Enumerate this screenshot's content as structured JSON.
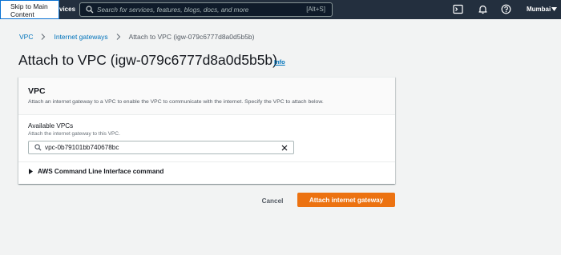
{
  "topnav": {
    "skip_link": "Skip to Main Content",
    "services_fragment": "vices",
    "search": {
      "placeholder": "Search for services, features, blogs, docs, and more",
      "shortcut": "[Alt+S]"
    },
    "icons": [
      "cloudshell-icon",
      "bell-icon",
      "help-icon"
    ],
    "region": "Mumbai"
  },
  "breadcrumb": {
    "items": [
      "VPC",
      "Internet gateways"
    ],
    "current": "Attach to VPC (igw-079c6777d8a0d5b5b)"
  },
  "page": {
    "title": "Attach to VPC (igw-079c6777d8a0d5b5b)",
    "info_link": "Info"
  },
  "vpc_section": {
    "title": "VPC",
    "description": "Attach an internet gateway to a VPC to enable the VPC to communicate with the internet. Specify the VPC to attach below.",
    "field_label": "Available VPCs",
    "field_description": "Attach the internet gateway to this VPC.",
    "field_value": "vpc-0b79101bb740678bc",
    "cli_toggle": "AWS Command Line Interface command"
  },
  "actions": {
    "cancel": "Cancel",
    "primary": "Attach internet gateway"
  },
  "colors": {
    "nav_bg": "#232f3e",
    "page_bg": "#f2f3f3",
    "link": "#0073bb",
    "primary_button": "#ec7211"
  }
}
